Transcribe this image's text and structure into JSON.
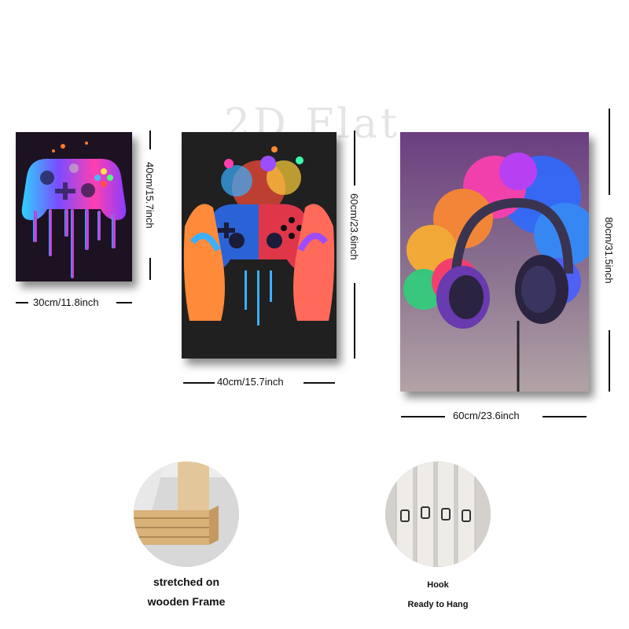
{
  "watermark": "2D Flat",
  "panels": [
    {
      "name": "controller-drip-panel",
      "width_label": "30cm/11.8inch",
      "height_label": "40cm/15.7inch"
    },
    {
      "name": "hands-controller-panel",
      "width_label": "40cm/15.7inch",
      "height_label": "60cm/23.6inch"
    },
    {
      "name": "headphones-smoke-panel",
      "width_label": "60cm/23.6inch",
      "height_label": "80cm/31.5inch"
    }
  ],
  "features": {
    "frame_caption_line1": "stretched on",
    "frame_caption_line2": "wooden Frame",
    "hook_caption_line1": "Hook",
    "hook_caption_line2": "Ready to Hang"
  }
}
